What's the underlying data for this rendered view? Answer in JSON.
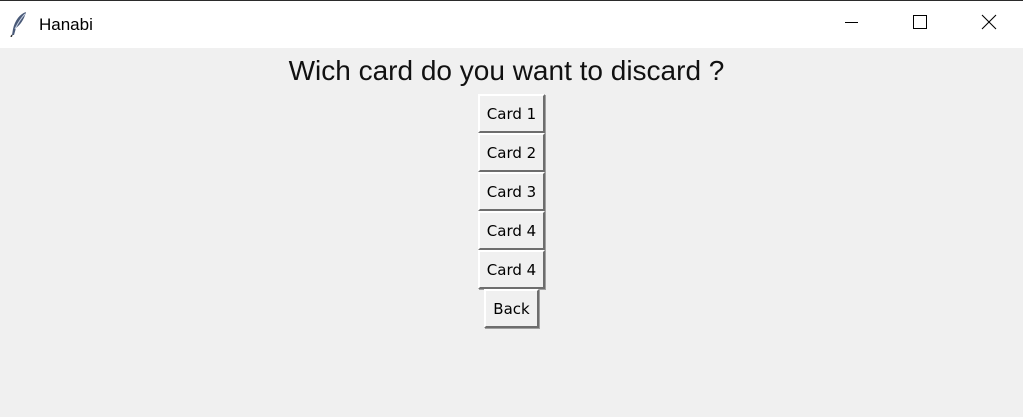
{
  "window": {
    "title": "Hanabi",
    "icon": "feather-icon",
    "controls": [
      "minimize-icon",
      "maximize-icon",
      "close-icon"
    ]
  },
  "prompt": "Wich card do you want to discard ?",
  "cards": [
    {
      "label": "Card 1"
    },
    {
      "label": "Card 2"
    },
    {
      "label": "Card 3"
    },
    {
      "label": "Card 4"
    },
    {
      "label": "Card 4"
    }
  ],
  "back_label": "Back"
}
